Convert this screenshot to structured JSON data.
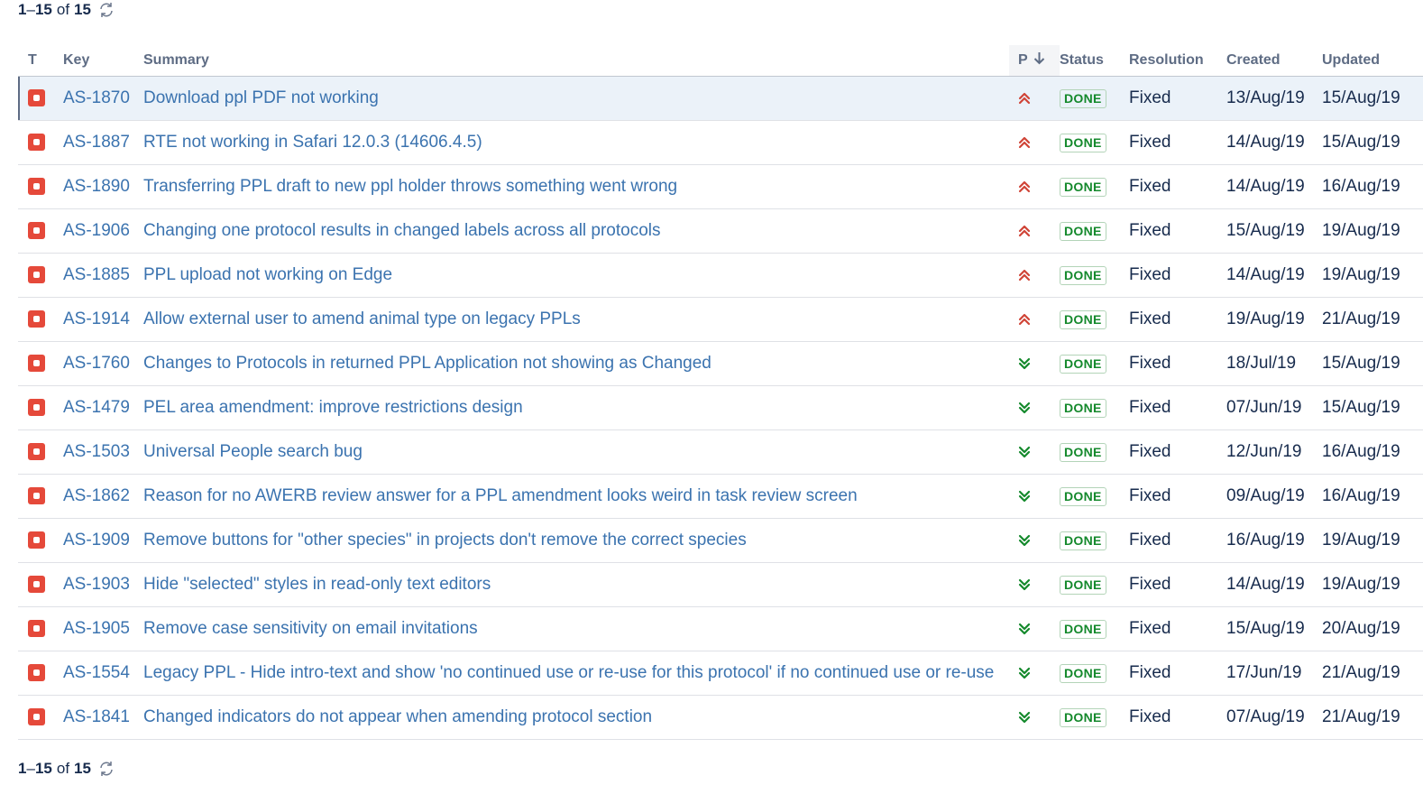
{
  "pager_top": {
    "start": "1",
    "end": "15",
    "of": "of",
    "total": "15"
  },
  "pager_bottom": {
    "start": "1",
    "end": "15",
    "of": "of",
    "total": "15"
  },
  "columns": {
    "type": "T",
    "key": "Key",
    "summary": "Summary",
    "priority": "P",
    "status": "Status",
    "resolution": "Resolution",
    "created": "Created",
    "updated": "Updated"
  },
  "sort": {
    "column": "priority",
    "direction": "descending",
    "icon": "arrow-down-icon"
  },
  "colors": {
    "link": "#3b73af",
    "bug": "#e5493a",
    "highest": "#d04437",
    "lowest": "#14892c",
    "done": "#14892c",
    "selected_row": "#ebf2f9"
  },
  "issues": [
    {
      "key": "AS-1870",
      "summary": "Download ppl PDF not working",
      "priority": "highest",
      "status": "DONE",
      "resolution": "Fixed",
      "created": "13/Aug/19",
      "updated": "15/Aug/19",
      "selected": true
    },
    {
      "key": "AS-1887",
      "summary": "RTE not working in Safari 12.0.3 (14606.4.5)",
      "priority": "highest",
      "status": "DONE",
      "resolution": "Fixed",
      "created": "14/Aug/19",
      "updated": "15/Aug/19"
    },
    {
      "key": "AS-1890",
      "summary": "Transferring PPL draft to new ppl holder throws something went wrong",
      "priority": "highest",
      "status": "DONE",
      "resolution": "Fixed",
      "created": "14/Aug/19",
      "updated": "16/Aug/19"
    },
    {
      "key": "AS-1906",
      "summary": "Changing one protocol results in changed labels across all protocols",
      "priority": "highest",
      "status": "DONE",
      "resolution": "Fixed",
      "created": "15/Aug/19",
      "updated": "19/Aug/19"
    },
    {
      "key": "AS-1885",
      "summary": "PPL upload not working on Edge",
      "priority": "highest",
      "status": "DONE",
      "resolution": "Fixed",
      "created": "14/Aug/19",
      "updated": "19/Aug/19"
    },
    {
      "key": "AS-1914",
      "summary": "Allow external user to amend animal type on legacy PPLs",
      "priority": "highest",
      "status": "DONE",
      "resolution": "Fixed",
      "created": "19/Aug/19",
      "updated": "21/Aug/19"
    },
    {
      "key": "AS-1760",
      "summary": "Changes to Protocols in returned PPL Application not showing as Changed",
      "priority": "lowest",
      "status": "DONE",
      "resolution": "Fixed",
      "created": "18/Jul/19",
      "updated": "15/Aug/19"
    },
    {
      "key": "AS-1479",
      "summary": "PEL area amendment: improve restrictions design",
      "priority": "lowest",
      "status": "DONE",
      "resolution": "Fixed",
      "created": "07/Jun/19",
      "updated": "15/Aug/19"
    },
    {
      "key": "AS-1503",
      "summary": "Universal People search bug",
      "priority": "lowest",
      "status": "DONE",
      "resolution": "Fixed",
      "created": "12/Jun/19",
      "updated": "16/Aug/19"
    },
    {
      "key": "AS-1862",
      "summary": "Reason for no AWERB review answer for a PPL amendment looks weird in task review screen",
      "priority": "lowest",
      "status": "DONE",
      "resolution": "Fixed",
      "created": "09/Aug/19",
      "updated": "16/Aug/19"
    },
    {
      "key": "AS-1909",
      "summary": "Remove buttons for \"other species\" in projects don't remove the correct species",
      "priority": "lowest",
      "status": "DONE",
      "resolution": "Fixed",
      "created": "16/Aug/19",
      "updated": "19/Aug/19"
    },
    {
      "key": "AS-1903",
      "summary": "Hide \"selected\" styles in read-only text editors",
      "priority": "lowest",
      "status": "DONE",
      "resolution": "Fixed",
      "created": "14/Aug/19",
      "updated": "19/Aug/19"
    },
    {
      "key": "AS-1905",
      "summary": "Remove case sensitivity on email invitations",
      "priority": "lowest",
      "status": "DONE",
      "resolution": "Fixed",
      "created": "15/Aug/19",
      "updated": "20/Aug/19"
    },
    {
      "key": "AS-1554",
      "summary": "Legacy PPL - Hide intro-text and show 'no continued use or re-use for this protocol' if no continued use or re-use",
      "priority": "lowest",
      "status": "DONE",
      "resolution": "Fixed",
      "created": "17/Jun/19",
      "updated": "21/Aug/19"
    },
    {
      "key": "AS-1841",
      "summary": "Changed indicators do not appear when amending protocol section",
      "priority": "lowest",
      "status": "DONE",
      "resolution": "Fixed",
      "created": "07/Aug/19",
      "updated": "21/Aug/19"
    }
  ]
}
